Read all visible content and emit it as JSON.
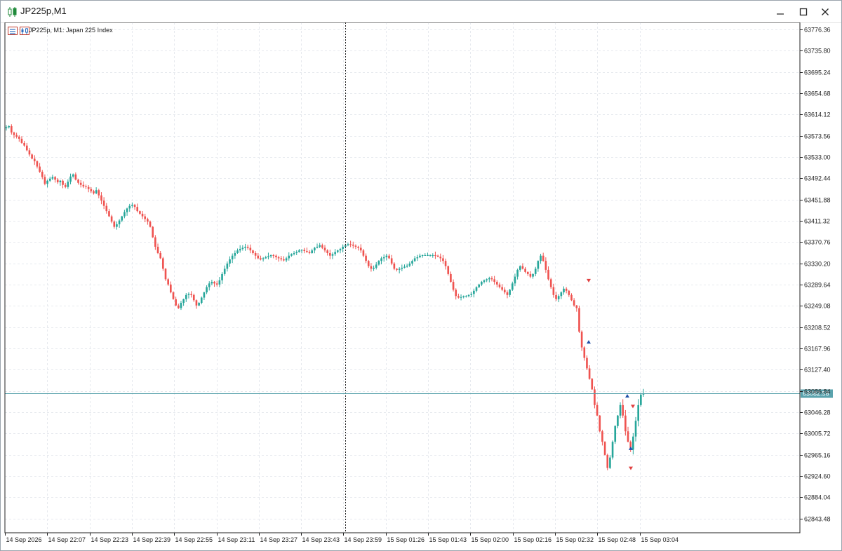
{
  "window": {
    "title": "JP225p,M1",
    "minimize_icon": "minimize-icon",
    "maximize_icon": "maximize-icon",
    "close_icon": "close-icon"
  },
  "chart_header": {
    "text": "JP225p, M1:  Japan 225 Index"
  },
  "colors": {
    "bull": "#26a69a",
    "bear": "#ef5350",
    "bid_line": "#5aa3ad",
    "grid": "#e6e9ee",
    "price_tag_bg": "#5aa3ad",
    "trade_buy": "#1f4fa8",
    "trade_sell": "#e04040"
  },
  "chart_data": {
    "type": "candlestick",
    "title": "JP225p, M1:  Japan 225 Index",
    "y_ticks": [
      "63776.36",
      "63735.80",
      "63695.24",
      "63654.68",
      "63614.12",
      "63573.56",
      "63533.00",
      "63492.44",
      "63451.88",
      "63411.32",
      "63370.76",
      "63330.20",
      "63289.64",
      "63249.08",
      "63208.52",
      "63167.96",
      "63127.40",
      "63086.84",
      "63046.28",
      "63005.72",
      "62965.16",
      "62924.60",
      "62884.04",
      "62843.48"
    ],
    "ylim": [
      62816.44,
      63789.88
    ],
    "x_ticks": [
      "14 Sep 2026",
      "14 Sep 22:07",
      "14 Sep 22:23",
      "14 Sep 22:39",
      "14 Sep 22:55",
      "14 Sep 23:11",
      "14 Sep 23:27",
      "14 Sep 23:43",
      "14 Sep 23:59",
      "15 Sep 01:26",
      "15 Sep 01:43",
      "15 Sep 02:00",
      "15 Sep 02:16",
      "15 Sep 02:32",
      "15 Sep 02:48",
      "15 Sep 03:04"
    ],
    "current_price": "63082.56",
    "cursor_x_label": "14 Sep 23:59",
    "grid": true,
    "close_series": [
      63590,
      63592,
      63580,
      63575,
      63572,
      63568,
      63560,
      63555,
      63546,
      63538,
      63530,
      63525,
      63515,
      63505,
      63495,
      63482,
      63488,
      63492,
      63495,
      63490,
      63485,
      63488,
      63480,
      63476,
      63486,
      63496,
      63500,
      63490,
      63484,
      63480,
      63477,
      63476,
      63472,
      63468,
      63464,
      63470,
      63460,
      63450,
      63440,
      63430,
      63420,
      63410,
      63400,
      63405,
      63412,
      63420,
      63428,
      63435,
      63440,
      63442,
      63438,
      63430,
      63425,
      63420,
      63415,
      63410,
      63400,
      63380,
      63362,
      63350,
      63340,
      63320,
      63300,
      63290,
      63275,
      63262,
      63250,
      63245,
      63255,
      63262,
      63270,
      63272,
      63270,
      63260,
      63250,
      63255,
      63265,
      63275,
      63285,
      63292,
      63295,
      63292,
      63290,
      63298,
      63310,
      63320,
      63330,
      63338,
      63345,
      63350,
      63355,
      63358,
      63360,
      63362,
      63360,
      63355,
      63350,
      63345,
      63340,
      63338,
      63340,
      63342,
      63344,
      63346,
      63345,
      63342,
      63340,
      63338,
      63336,
      63340,
      63345,
      63348,
      63350,
      63352,
      63355,
      63356,
      63354,
      63352,
      63350,
      63355,
      63360,
      63362,
      63365,
      63360,
      63355,
      63350,
      63345,
      63348,
      63352,
      63355,
      63358,
      63362,
      63365,
      63367,
      63366,
      63364,
      63362,
      63360,
      63355,
      63345,
      63335,
      63325,
      63320,
      63322,
      63328,
      63335,
      63340,
      63342,
      63345,
      63340,
      63330,
      63320,
      63318,
      63320,
      63322,
      63324,
      63326,
      63330,
      63335,
      63340,
      63342,
      63345,
      63346,
      63346,
      63346,
      63346,
      63346,
      63345,
      63343,
      63340,
      63335,
      63325,
      63310,
      63295,
      63280,
      63268,
      63265,
      63266,
      63268,
      63268,
      63270,
      63272,
      63278,
      63285,
      63290,
      63295,
      63298,
      63300,
      63302,
      63300,
      63295,
      63290,
      63285,
      63280,
      63275,
      63270,
      63280,
      63292,
      63305,
      63318,
      63325,
      63320,
      63314,
      63310,
      63305,
      63310,
      63320,
      63335,
      63345,
      63335,
      63318,
      63300,
      63285,
      63270,
      63262,
      63268,
      63275,
      63282,
      63278,
      63270,
      63260,
      63250,
      63245,
      63200,
      63170,
      63150,
      63130,
      63110,
      63090,
      63060,
      63040,
      63010,
      62990,
      62965,
      62940,
      62960,
      62990,
      63020,
      63040,
      63060,
      63040,
      63010,
      62990,
      62975,
      63000,
      63030,
      63060,
      63080,
      63082.56
    ]
  }
}
